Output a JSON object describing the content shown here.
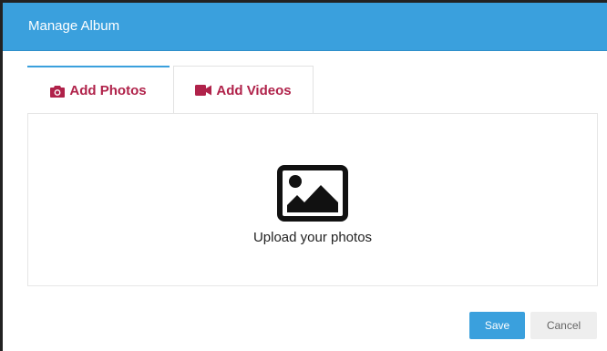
{
  "dialog": {
    "title": "Manage Album"
  },
  "tabs": [
    {
      "label": "Add Photos",
      "icon": "camera-icon",
      "active": true
    },
    {
      "label": "Add Videos",
      "icon": "video-camera-icon",
      "active": false
    }
  ],
  "upload": {
    "icon": "image-icon",
    "text": "Upload your photos"
  },
  "footer": {
    "save_label": "Save",
    "cancel_label": "Cancel"
  },
  "colors": {
    "header": "#3aa0dd",
    "tab_text": "#b0224a",
    "save_button": "#3aa0dd",
    "cancel_button": "#eeeeee"
  }
}
